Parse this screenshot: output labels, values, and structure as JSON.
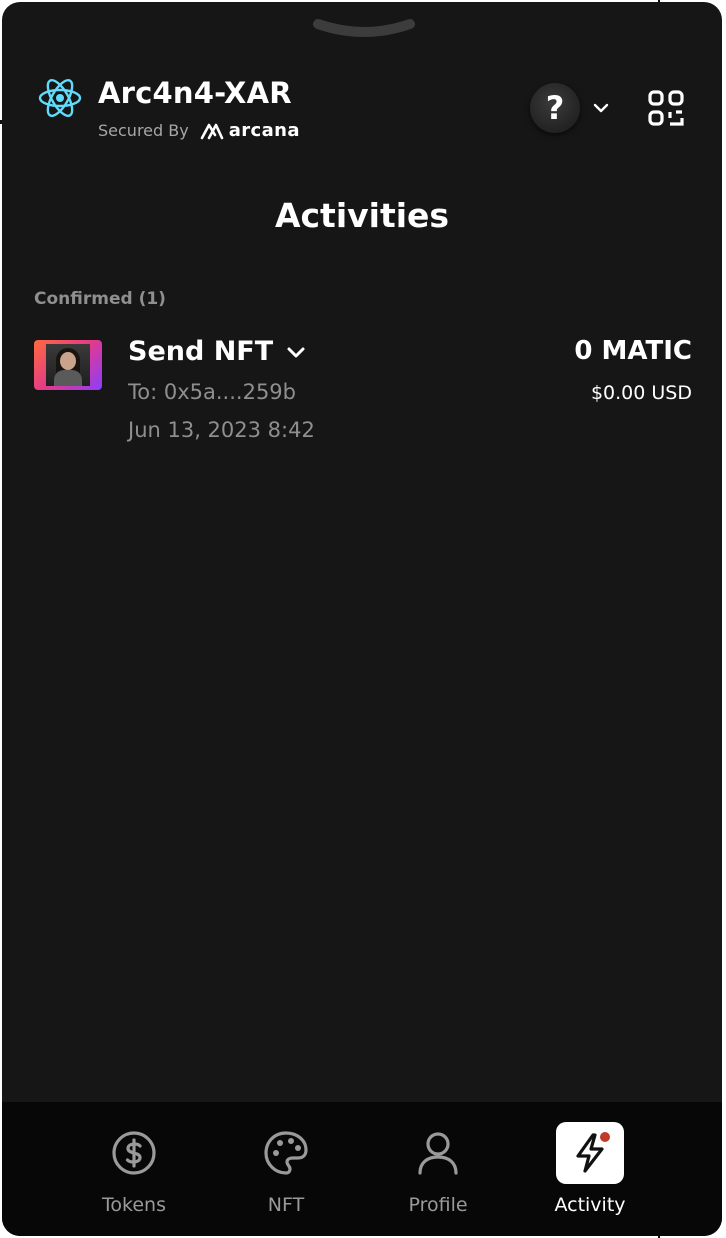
{
  "header": {
    "app_name": "Arc4n4-XAR",
    "secured_by": "Secured By",
    "brand_name": "arcana",
    "help_symbol": "?",
    "icons": {
      "logo": "atom-logo-icon",
      "help": "help-icon",
      "dropdown": "chevron-down-icon",
      "qr": "qr-code-icon"
    }
  },
  "page": {
    "title": "Activities"
  },
  "activity": {
    "section_label": "Confirmed (1)",
    "items": [
      {
        "title": "Send NFT",
        "to": "To: 0x5a....259b",
        "date": "Jun 13, 2023 8:42",
        "amount": "0 MATIC",
        "usd": "$0.00 USD"
      }
    ]
  },
  "nav": {
    "items": [
      {
        "label": "Tokens",
        "icon": "dollar-icon",
        "active": false
      },
      {
        "label": "NFT",
        "icon": "palette-icon",
        "active": false
      },
      {
        "label": "Profile",
        "icon": "user-icon",
        "active": false
      },
      {
        "label": "Activity",
        "icon": "lightning-icon",
        "active": true,
        "notification": true
      }
    ]
  },
  "colors": {
    "background": "#161616",
    "nav_background": "#070707",
    "text_primary": "#ffffff",
    "text_muted": "#8f8f8f",
    "accent_logo": "#61dafb",
    "notification": "#c0392b"
  }
}
